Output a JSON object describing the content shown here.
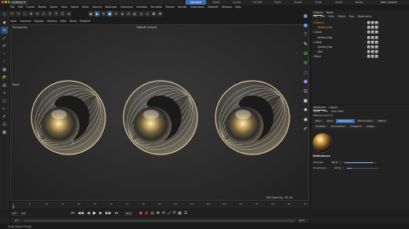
{
  "title_bar": {
    "doc_tab": "Untitled 9",
    "layout_tabs": [
      {
        "label": "Standard",
        "active": true
      },
      {
        "label": "Model",
        "active": false
      },
      {
        "label": "Sculpt",
        "active": false
      },
      {
        "label": "UV Edit",
        "active": false
      },
      {
        "label": "Paint",
        "active": false
      },
      {
        "label": "Groom",
        "active": false
      },
      {
        "label": "Track",
        "active": false
      },
      {
        "label": "Script",
        "active": false
      },
      {
        "label": "Nodes",
        "active": false
      }
    ],
    "new_layouts": "New Layouts"
  },
  "menubar": [
    "File",
    "Edit",
    "Create",
    "Modes",
    "Select",
    "Tools",
    "Spline",
    "Mesh",
    "Volume",
    "MoGraph",
    "Character",
    "Animate",
    "Simulate",
    "Tracker",
    "Render",
    "Extensions",
    "Redshift",
    "Window",
    "Help"
  ],
  "viewport": {
    "menu": [
      "View",
      "Cameras",
      "Display",
      "Options",
      "Filter",
      "Panel",
      "Redshift"
    ],
    "label_left": "Perspective",
    "label_center": "Default Camera",
    "move_label": "Move",
    "grid_spacing": "Grid Spacing : 50 cm"
  },
  "objects_panel": {
    "tabs": [
      "Objects",
      "Takes"
    ],
    "menu": [
      "File",
      "Edit",
      "View",
      "Object",
      "Tags",
      "Bookmarks"
    ],
    "items": [
      {
        "name": "Cloner.2",
        "indent": 0,
        "color": "#e9a13b"
      },
      {
        "name": "Sphere_Fast",
        "indent": 1,
        "color": "#e9a13b"
      },
      {
        "name": "Cloner",
        "indent": 0,
        "color": "#cfcfcf"
      },
      {
        "name": "Sphere_Fast",
        "indent": 1,
        "color": "#cfcfcf"
      },
      {
        "name": "Cloner",
        "indent": 0,
        "color": "#cfcfcf"
      },
      {
        "name": "Sphere_Fast",
        "indent": 1,
        "color": "#cfcfcf"
      },
      {
        "name": "Disc",
        "indent": 1,
        "color": "#cfcfcf"
      },
      {
        "name": "Plane",
        "indent": 0,
        "color": "#cfcfcf"
      }
    ]
  },
  "attributes_panel": {
    "tabs": [
      "Attributes",
      "Layers"
    ],
    "menu": [
      "Mode",
      "Edit",
      "User Data"
    ],
    "object_name": "Material [Gold 1]",
    "subtabs_row1": [
      {
        "label": "Basic",
        "selected": false
      },
      {
        "label": "Base",
        "selected": false
      },
      {
        "label": "Reflectance",
        "selected": true
      },
      {
        "label": "Deformation",
        "selected": false
      },
      {
        "label": "Patina",
        "selected": false
      }
    ],
    "subtabs_row2": [
      {
        "label": "Variation",
        "selected": false
      },
      {
        "label": "Illumination",
        "selected": false
      },
      {
        "label": "Viewport",
        "selected": false
      },
      {
        "label": "Assign",
        "selected": false
      }
    ],
    "section": "Reflectance",
    "params": [
      {
        "label": "Strength",
        "value": "90 %",
        "fraction": 0.9
      },
      {
        "label": "Roughness",
        "value": "14 %",
        "fraction": 0.14
      }
    ]
  },
  "timeline": {
    "ticks": [
      "0",
      "5",
      "10",
      "15",
      "20",
      "25",
      "30",
      "35",
      "40",
      "45",
      "50",
      "55",
      "60",
      "65",
      "70",
      "75",
      "80",
      "85",
      "90"
    ],
    "current_frame": "0 F",
    "start_frame": "0 F",
    "end_frame": "90 F",
    "range_start": "0 F",
    "range_end": "90 F"
  },
  "statusbar": "Drag Object (Drag)",
  "colors": {
    "accent": "#3b6fb7",
    "orange": "#e9a13b",
    "record": "#d34a4a"
  }
}
